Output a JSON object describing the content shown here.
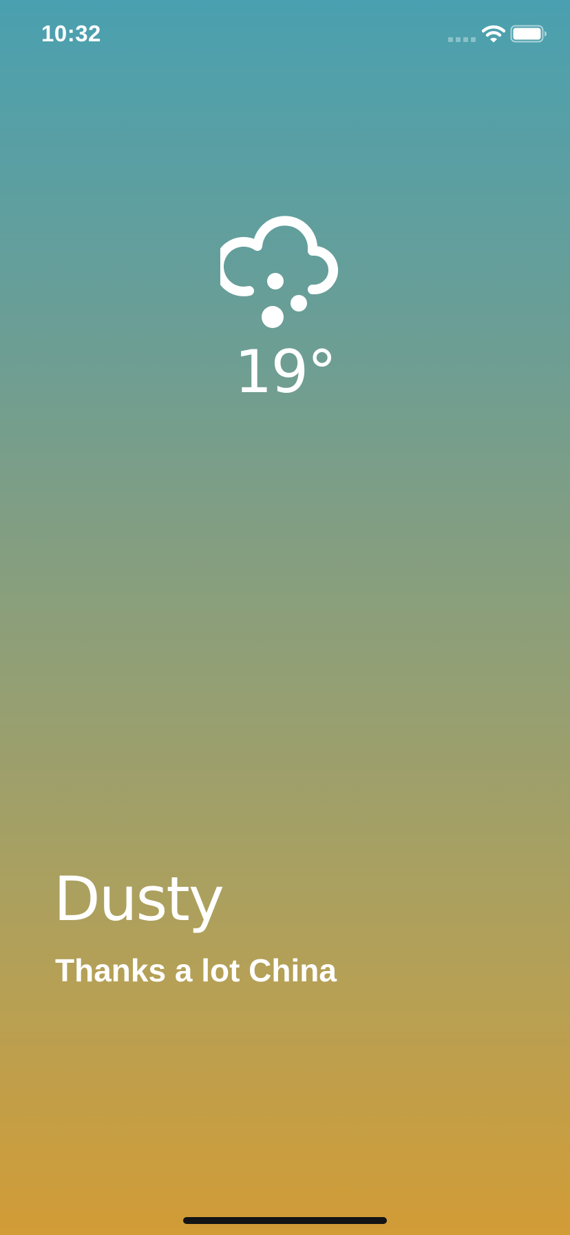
{
  "status_bar": {
    "time": "10:32",
    "signal_icon": "cellular-signal-icon",
    "wifi_icon": "wifi-icon",
    "battery_icon": "battery-full-icon"
  },
  "weather": {
    "icon": "cloud-hail-icon",
    "temperature": "19°",
    "condition": "Dusty",
    "message": "Thanks a lot China"
  },
  "colors": {
    "gradient_top": "#4aa0b0",
    "gradient_bottom": "#d29c36",
    "text": "#ffffff",
    "home_indicator": "#141414"
  }
}
